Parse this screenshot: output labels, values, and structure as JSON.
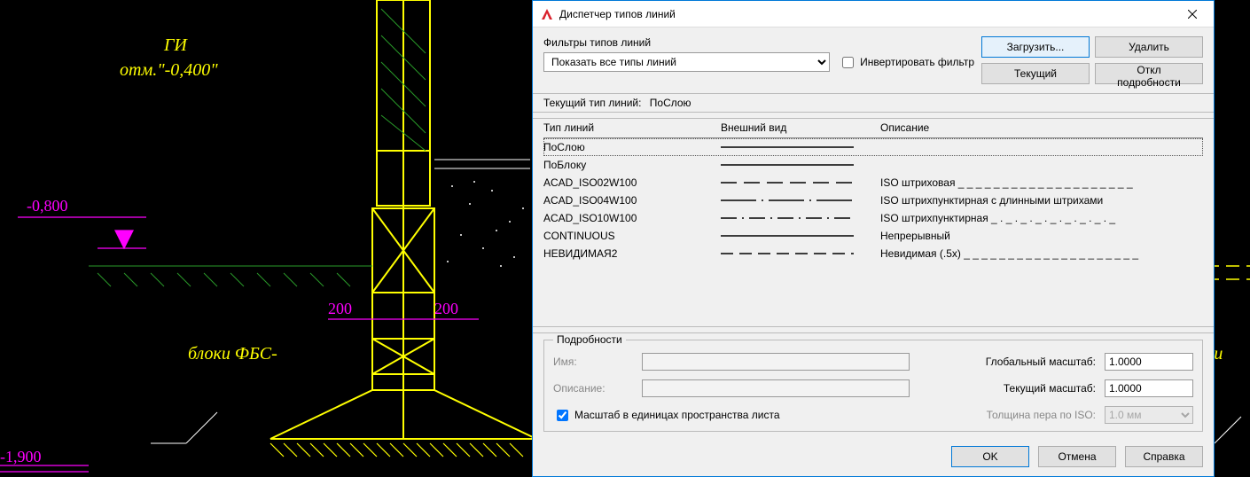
{
  "cad": {
    "gi": "ГИ",
    "otm": "отм.\"-0,400\"",
    "fbs": "блоки ФБС-",
    "m08": "-0,800",
    "m19": "-1,900",
    "d200a": "200",
    "d200b": "200",
    "ki": "ки"
  },
  "dialog": {
    "title": "Диспетчер типов линий",
    "filters_label": "Фильтры типов линий",
    "filter_selected": "Показать все типы линий",
    "invert_label": "Инвертировать фильтр",
    "btn_load": "Загрузить...",
    "btn_delete": "Удалить",
    "btn_current": "Текущий",
    "btn_details": "Откл подробности",
    "current_lt_label": "Текущий тип линий:",
    "current_lt_value": "ПоСлою",
    "col_name": "Тип линий",
    "col_app": "Внешний вид",
    "col_desc": "Описание",
    "rows": [
      {
        "name": "ПоСлою",
        "pattern": "solid",
        "desc": ""
      },
      {
        "name": "ПоБлоку",
        "pattern": "solid",
        "desc": ""
      },
      {
        "name": "ACAD_ISO02W100",
        "pattern": "dash",
        "desc": "ISO штриховая _ _ _ _ _ _ _ _ _ _ _ _ _ _ _ _ _ _ _ _"
      },
      {
        "name": "ACAD_ISO04W100",
        "pattern": "dashdotlong",
        "desc": "ISO штрихпунктирная с длинными штрихами"
      },
      {
        "name": "ACAD_ISO10W100",
        "pattern": "dashdot",
        "desc": "ISO штрихпунктирная _ . _ . _ . _ . _ . _ . _ . _ . _"
      },
      {
        "name": "CONTINUOUS",
        "pattern": "solid",
        "desc": "Непрерывный"
      },
      {
        "name": "НЕВИДИМАЯ2",
        "pattern": "hidden",
        "desc": "Невидимая (.5x) _ _ _ _ _ _ _ _ _ _ _ _ _ _ _ _ _ _ _ _"
      }
    ],
    "details_legend": "Подробности",
    "name_label": "Имя:",
    "desc_label": "Описание:",
    "paperspace_label": "Масштаб в единицах пространства листа",
    "global_scale_label": "Глобальный масштаб:",
    "current_scale_label": "Текущий масштаб:",
    "iso_pen_label": "Толщина пера по ISO:",
    "global_scale": "1.0000",
    "current_scale": "1.0000",
    "iso_pen": "1.0 мм",
    "btn_ok": "OK",
    "btn_cancel": "Отмена",
    "btn_help": "Справка"
  }
}
